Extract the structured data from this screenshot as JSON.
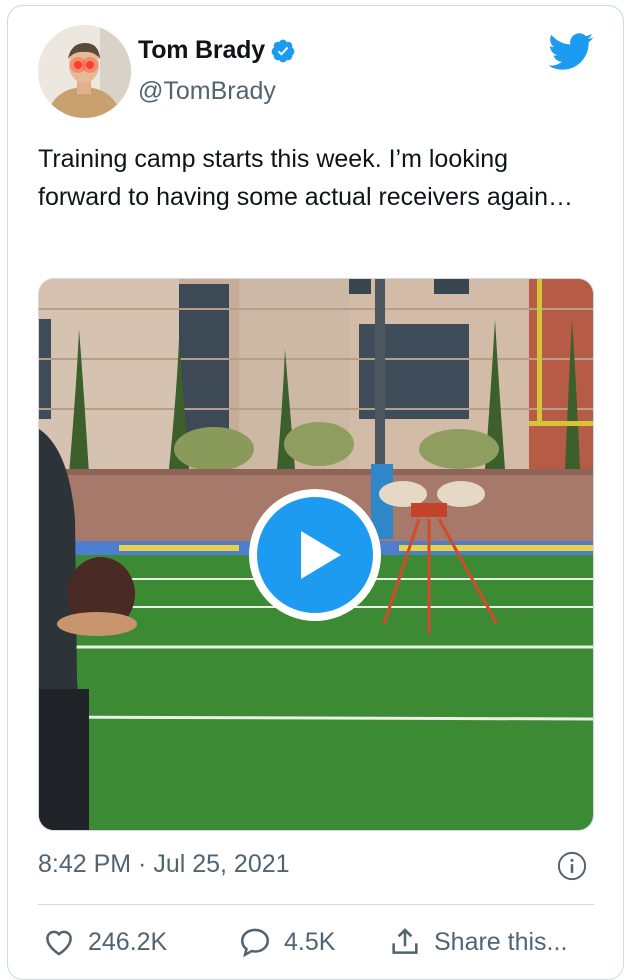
{
  "tweet": {
    "author_name": "Tom Brady",
    "author_handle": "@TomBrady",
    "text": "Training camp starts this week. I’m looking forward to having some actual receivers again…",
    "timestamp": "8:42 PM · Jul 25, 2021",
    "likes": "246.2K",
    "replies": "4.5K",
    "share_label": "Share this..."
  },
  "icons": {
    "verified": "verified-badge-icon",
    "brand": "twitter-bird-icon",
    "info": "info-icon",
    "like": "heart-icon",
    "reply": "speech-bubble-icon",
    "share": "share-icon",
    "play": "play-icon"
  },
  "colors": {
    "accent": "#1d9bf0",
    "secondary_text": "#536471",
    "border": "#cfd9de"
  }
}
